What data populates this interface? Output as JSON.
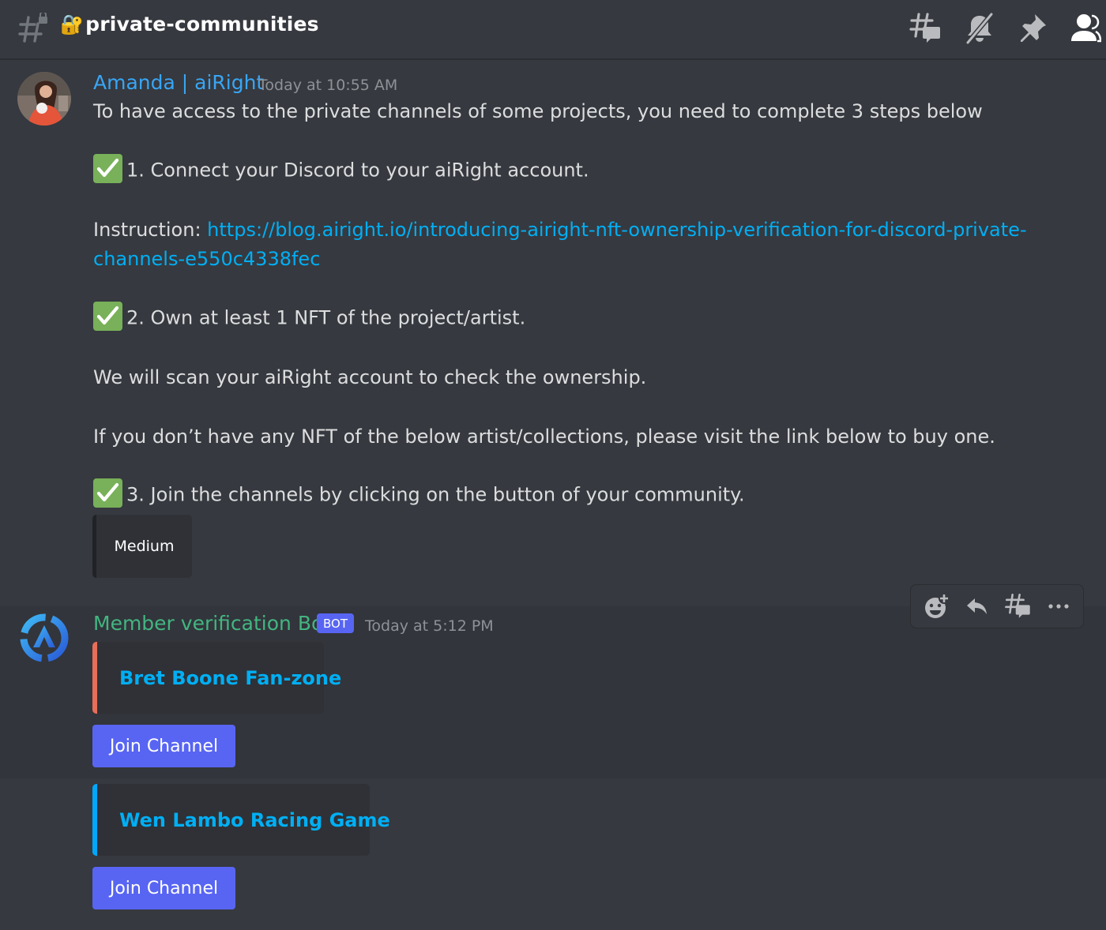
{
  "header": {
    "lock_emoji": "🔐",
    "channel_name": "private-communities",
    "icons": [
      "hashtag-lock-icon",
      "threads-icon",
      "mute-bell-icon",
      "pin-icon",
      "member-list-icon"
    ]
  },
  "messages": [
    {
      "author": "Amanda | aiRight",
      "author_color": "#38a6f5",
      "timestamp": "Today at 10:55 AM",
      "lines": {
        "intro": "To have access to the private channels of some projects, you need to complete 3 steps below",
        "step1": "1. Connect your Discord to your aiRight account.",
        "instruction_label": "Instruction: ",
        "instruction_link_1": "https://blog.airight.io/introducing-airight-nft-ownership-verification-for-discord-private-",
        "instruction_link_2": "channels-e550c4338fec",
        "step2": "2. Own at least 1 NFT of the project/artist.",
        "scan_note": "We will scan your aiRight account to check the ownership.",
        "buy_note": "If you don’t have any NFT of the below artist/collections, please visit the link below to buy one.",
        "step3": "3. Join the channels by clicking on the button of your community."
      },
      "embed_button": "Medium"
    },
    {
      "author": "Member verification Bot",
      "author_color": "#43b581",
      "badge": "BOT",
      "timestamp": "Today at 5:12 PM",
      "embeds": [
        {
          "title": "Bret Boone Fan-zone",
          "accent": "#e86e5a",
          "button": "Join Channel"
        },
        {
          "title": "Wen Lambo Racing Game",
          "accent": "#00a8fc",
          "button": "Join Channel"
        }
      ]
    }
  ],
  "message_actions": [
    "add-reaction-icon",
    "reply-icon",
    "create-thread-icon",
    "more-icon"
  ],
  "colors": {
    "background": "#36393f",
    "link": "#00aff4",
    "blurple": "#5865f2",
    "check_green": "#78b159"
  }
}
